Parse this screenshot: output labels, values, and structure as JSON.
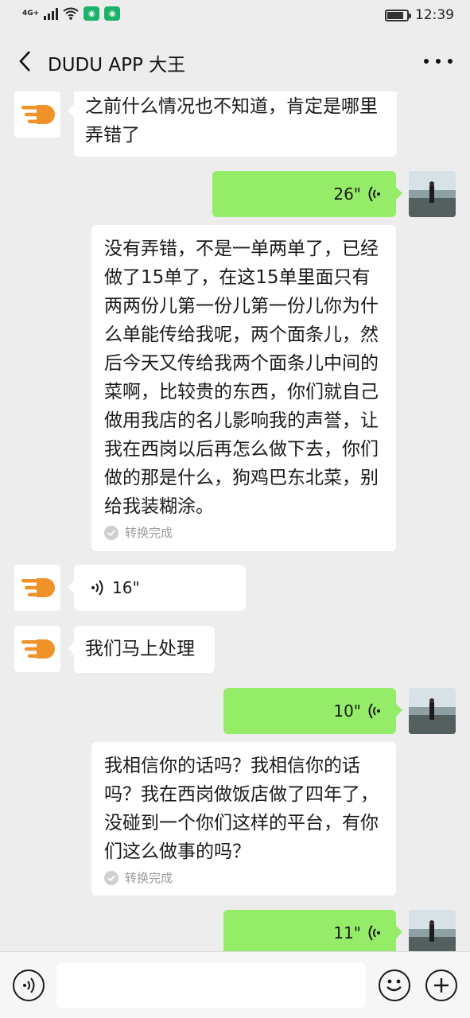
{
  "status_bar": {
    "network": "4G+",
    "time": "12:39",
    "battery_level": 0.85
  },
  "header": {
    "title": "DUDU APP 大王",
    "back_icon": "chevron-left-icon",
    "more_icon": "more-dots-icon"
  },
  "messages": [
    {
      "side": "left",
      "type": "text",
      "text": "之前什么情况也不知道，肯定是哪里弄错了"
    },
    {
      "side": "right",
      "type": "voice",
      "duration": "26\""
    },
    {
      "side": "right",
      "type": "transcript",
      "text": "没有弄错，不是一单两单了，已经做了15单了，在这15单里面只有两两份儿第一份儿第一份儿你为什么单能传给我呢，两个面条儿，然后今天又传给我两个面条儿中间的菜啊，比较贵的东西，你们就自己做用我店的名儿影响我的声誉，让我在西岗以后再怎么做下去，你们做的那是什么，狗鸡巴东北菜，别给我装糊涂。",
      "status": "转换完成"
    },
    {
      "side": "left",
      "type": "voice",
      "duration": "16\""
    },
    {
      "side": "left",
      "type": "text",
      "text": "我们马上处理"
    },
    {
      "side": "right",
      "type": "voice",
      "duration": "10\""
    },
    {
      "side": "right",
      "type": "transcript",
      "text": "我相信你的话吗？我相信你的话吗？我在西岗做饭店做了四年了，没碰到一个你们这样的平台，有你们这么做事的吗？",
      "status": "转换完成"
    },
    {
      "side": "right",
      "type": "voice",
      "duration": "11\""
    }
  ],
  "input_bar": {
    "voice_icon": "voice-mode-icon",
    "emoji_icon": "emoji-icon",
    "plus_icon": "plus-icon",
    "value": ""
  },
  "colors": {
    "background": "#ededed",
    "bubble_green": "#95ec69",
    "bubble_white": "#ffffff",
    "brand_orange": "#f0922a"
  }
}
